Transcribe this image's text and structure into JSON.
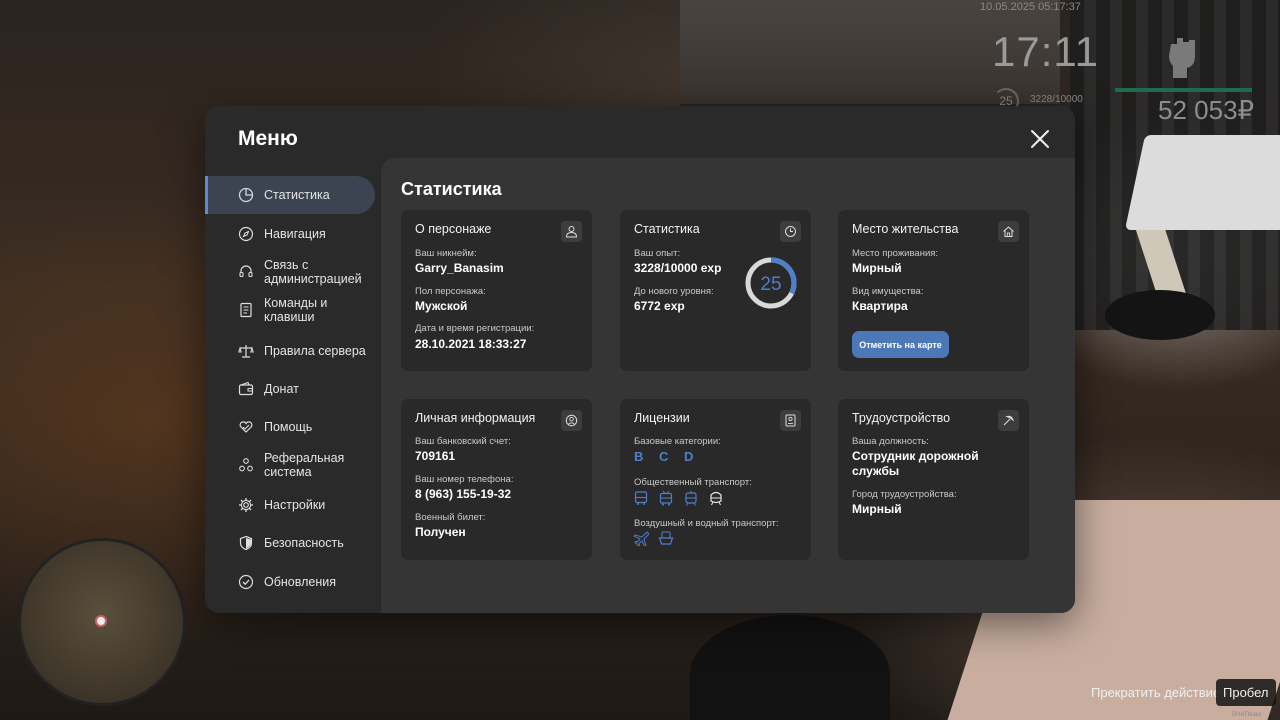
{
  "hud": {
    "datetime": "10.05.2025 05:17:37",
    "time": "17:11",
    "level": "25",
    "exp": "3228/10000",
    "money": "52 053₽",
    "minimap_marker": "player-marker"
  },
  "hints": {
    "action": "Прекратить действие",
    "key": "Пробел"
  },
  "watermark": "ВНАТМакс",
  "menu": {
    "title": "Меню",
    "sidebar": [
      {
        "label": "Статистика",
        "icon": "pie-chart-icon",
        "active": true
      },
      {
        "label": "Навигация",
        "icon": "compass-icon"
      },
      {
        "label": "Связь с администрацией",
        "icon": "headset-icon"
      },
      {
        "label": "Команды и клавиши",
        "icon": "document-icon"
      },
      {
        "label": "Правила сервера",
        "icon": "scales-icon"
      },
      {
        "label": "Донат",
        "icon": "wallet-icon"
      },
      {
        "label": "Помощь",
        "icon": "heart-hands-icon"
      },
      {
        "label": "Реферальная система",
        "icon": "referral-icon"
      },
      {
        "label": "Настройки",
        "icon": "gear-icon"
      },
      {
        "label": "Безопасность",
        "icon": "shield-icon"
      },
      {
        "label": "Обновления",
        "icon": "check-circle-icon"
      }
    ],
    "content_title": "Статистика",
    "cards": {
      "character": {
        "title": "О персонаже",
        "nickname_label": "Ваш никнейм:",
        "nickname": "Garry_Banasim",
        "gender_label": "Пол персонажа:",
        "gender": "Мужской",
        "reg_label": "Дата и время регистрации:",
        "reg_date": "28.10.2021 18:33:27"
      },
      "stats": {
        "title": "Статистика",
        "exp_label": "Ваш опыт:",
        "exp": "3228/10000 exp",
        "next_label": "До нового уровня:",
        "next": "6772 exp",
        "level": "25",
        "progress": 0.3228
      },
      "residence": {
        "title": "Место жительства",
        "place_label": "Место проживания:",
        "place": "Мирный",
        "property_label": "Вид имущества:",
        "property": "Квартира",
        "map_button": "Отметить на карте"
      },
      "personal": {
        "title": "Личная информация",
        "bank_label": "Ваш банковский счет:",
        "bank": "709161",
        "phone_label": "Ваш номер телефона:",
        "phone": "8 (963) 155-19-32",
        "military_label": "Военный билет:",
        "military": "Получен"
      },
      "licenses": {
        "title": "Лицензии",
        "basic_label": "Базовые категории:",
        "basic": "B C D",
        "public_label": "Общественный транспорт:",
        "public_icons": [
          "bus-icon",
          "trolleybus-icon",
          "tram-icon",
          "metro-icon"
        ],
        "air_label": "Воздушный и водный транспорт:",
        "air_icons": [
          "plane-icon",
          "boat-icon"
        ]
      },
      "employment": {
        "title": "Трудоустройство",
        "position_label": "Ваша должность:",
        "position": "Сотрудник дорожной службы",
        "city_label": "Город трудоустройства:",
        "city": "Мирный"
      }
    }
  },
  "colors": {
    "accent": "#4c78b8",
    "level_ring": "#4e7fca",
    "health": "#1f6b4f"
  }
}
